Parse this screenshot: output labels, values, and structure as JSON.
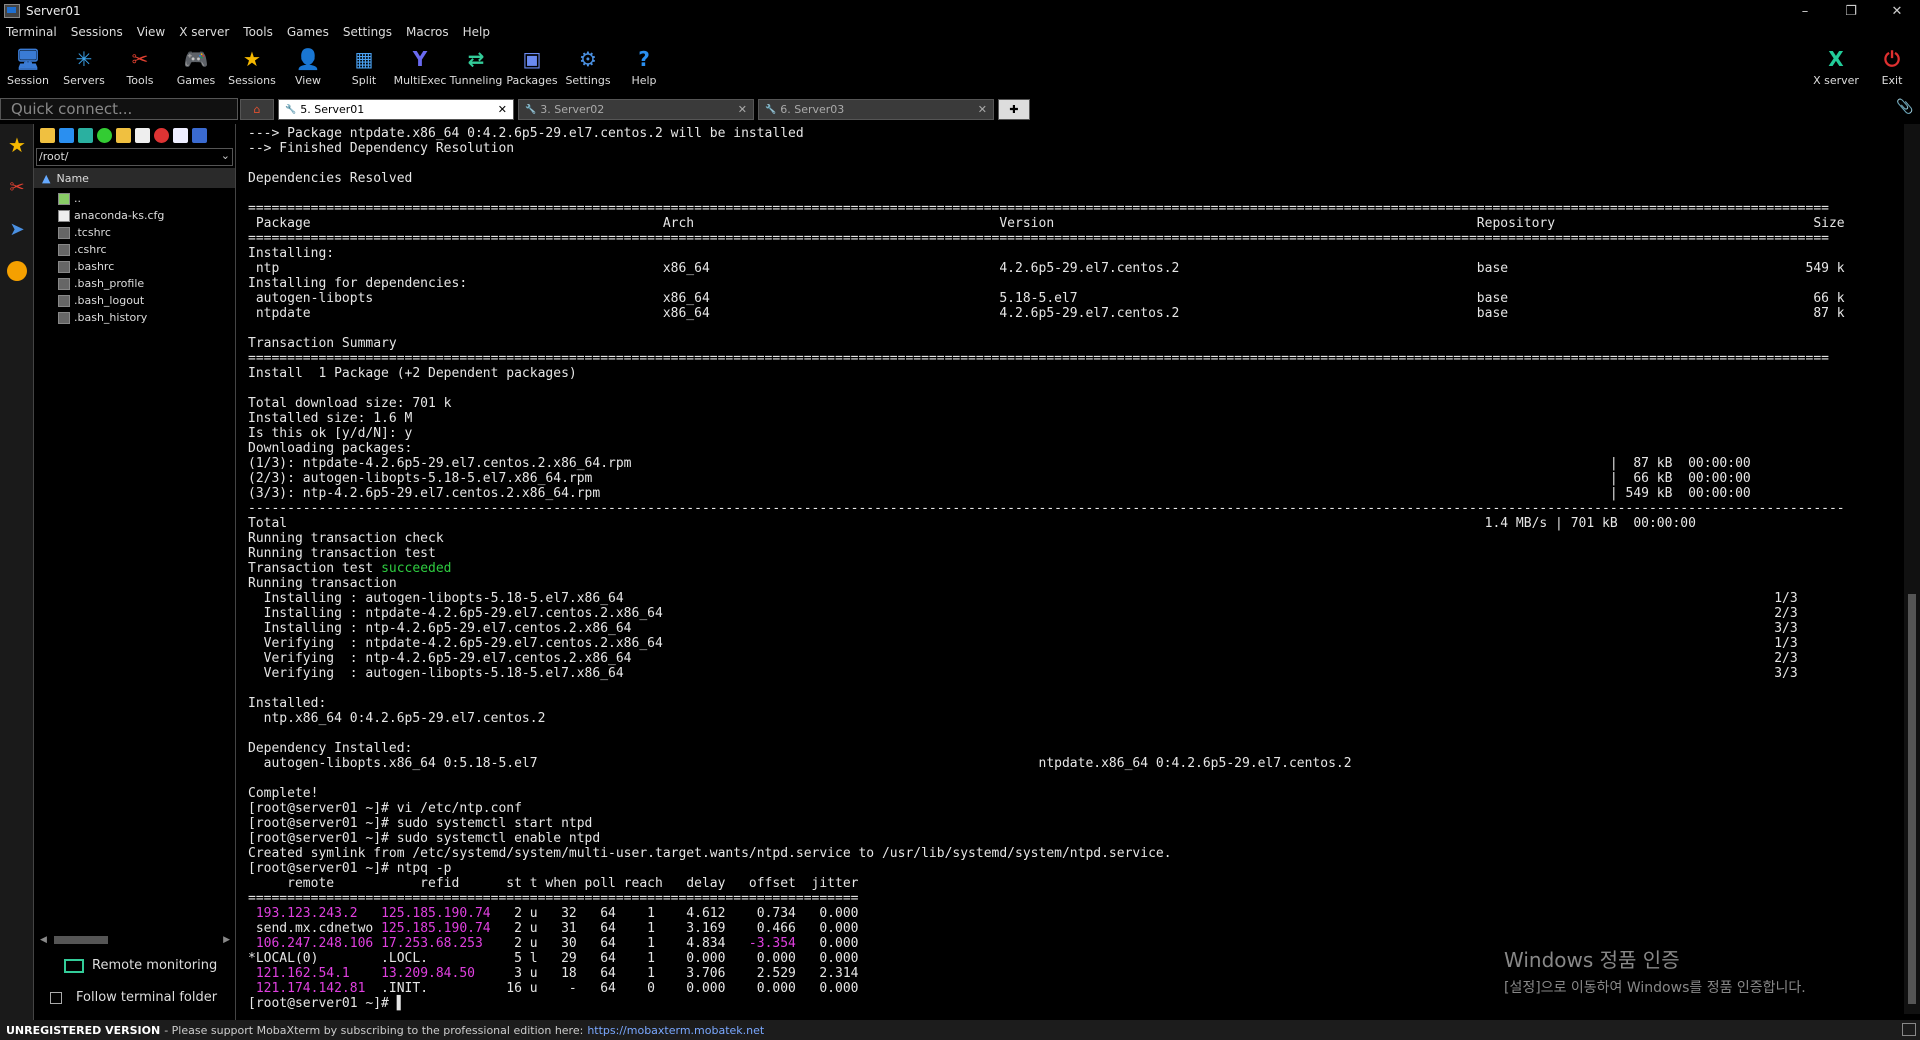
{
  "window": {
    "title": "Server01",
    "min": "–",
    "max": "❐",
    "close": "✕"
  },
  "menu": [
    "Terminal",
    "Sessions",
    "View",
    "X server",
    "Tools",
    "Games",
    "Settings",
    "Macros",
    "Help"
  ],
  "toolbar": [
    {
      "label": "Session",
      "icon": "session-icon",
      "glyph": "🖥",
      "color": "#3a7bd5"
    },
    {
      "label": "Servers",
      "icon": "servers-icon",
      "glyph": "✳",
      "color": "#3aa0e8"
    },
    {
      "label": "Tools",
      "icon": "tools-icon",
      "glyph": "✂",
      "color": "#e04030"
    },
    {
      "label": "Games",
      "icon": "games-icon",
      "glyph": "🎮",
      "color": "#bbbbbb"
    },
    {
      "label": "Sessions",
      "icon": "sessions-star-icon",
      "glyph": "★",
      "color": "#f5b800"
    },
    {
      "label": "View",
      "icon": "view-icon",
      "glyph": "👤",
      "color": "#9ab"
    },
    {
      "label": "Split",
      "icon": "split-icon",
      "glyph": "▦",
      "color": "#4aa0f0"
    },
    {
      "label": "MultiExec",
      "icon": "multiexec-icon",
      "glyph": "Y",
      "color": "#6a6af0"
    },
    {
      "label": "Tunneling",
      "icon": "tunneling-icon",
      "glyph": "⇄",
      "color": "#3c9"
    },
    {
      "label": "Packages",
      "icon": "packages-icon",
      "glyph": "▣",
      "color": "#6a8af0"
    },
    {
      "label": "Settings",
      "icon": "settings-gear-icon",
      "glyph": "⚙",
      "color": "#4a90e2"
    },
    {
      "label": "Help",
      "icon": "help-icon",
      "glyph": "?",
      "color": "#2a8ff0"
    }
  ],
  "toolbar_right": [
    {
      "label": "X server",
      "icon": "xserver-icon",
      "glyph": "X",
      "color": "#2c9"
    },
    {
      "label": "Exit",
      "icon": "exit-power-icon",
      "glyph": "⏻",
      "color": "#e03030"
    }
  ],
  "quick_connect": {
    "placeholder": "Quick connect..."
  },
  "tabs": [
    {
      "label": "5. Server01",
      "active": true
    },
    {
      "label": "3. Server02",
      "active": false
    },
    {
      "label": "6. Server03",
      "active": false
    }
  ],
  "sidebar": {
    "path": "/root/",
    "header": "Name",
    "files": [
      {
        "name": "..",
        "type": "up"
      },
      {
        "name": "anaconda-ks.cfg",
        "type": "doc"
      },
      {
        "name": ".tcshrc",
        "type": "file"
      },
      {
        "name": ".cshrc",
        "type": "file"
      },
      {
        "name": ".bashrc",
        "type": "file"
      },
      {
        "name": ".bash_profile",
        "type": "file"
      },
      {
        "name": ".bash_logout",
        "type": "file"
      },
      {
        "name": ".bash_history",
        "type": "file"
      }
    ],
    "remote_monitoring": "Remote monitoring",
    "follow_folder": "Follow terminal folder"
  },
  "terminal": {
    "lines": [
      [
        {
          "t": "---> Package ntpdate.x86_64 0:4.2.6p5-29.el7.centos.2 will be installed"
        }
      ],
      [
        {
          "t": "--> Finished Dependency Resolution"
        }
      ],
      [
        {
          "t": ""
        }
      ],
      [
        {
          "t": "Dependencies Resolved"
        }
      ],
      [
        {
          "t": ""
        }
      ],
      [
        {
          "t": "=========================================================================================================================================================================================================="
        }
      ],
      [
        {
          "t": " Package                                             Arch                                       Version                                                      Repository                                 Size"
        }
      ],
      [
        {
          "t": "=========================================================================================================================================================================================================="
        }
      ],
      [
        {
          "t": "Installing:"
        }
      ],
      [
        {
          "t": " ntp                                                 x86_64                                     4.2.6p5-29.el7.centos.2                                      base                                      549 k"
        }
      ],
      [
        {
          "t": "Installing for dependencies:"
        }
      ],
      [
        {
          "t": " autogen-libopts                                     x86_64                                     5.18-5.el7                                                   base                                       66 k"
        }
      ],
      [
        {
          "t": " ntpdate                                             x86_64                                     4.2.6p5-29.el7.centos.2                                      base                                       87 k"
        }
      ],
      [
        {
          "t": ""
        }
      ],
      [
        {
          "t": "Transaction Summary"
        }
      ],
      [
        {
          "t": "=========================================================================================================================================================================================================="
        }
      ],
      [
        {
          "t": "Install  1 Package (+2 Dependent packages)"
        }
      ],
      [
        {
          "t": ""
        }
      ],
      [
        {
          "t": "Total download size: 701 k"
        }
      ],
      [
        {
          "t": "Installed size: 1.6 M"
        }
      ],
      [
        {
          "t": "Is this ok [y/d/N]: y"
        }
      ],
      [
        {
          "t": "Downloading packages:"
        }
      ],
      [
        {
          "t": "(1/3): ntpdate-4.2.6p5-29.el7.centos.2.x86_64.rpm                                                                                                                             |  87 kB  00:00:00"
        }
      ],
      [
        {
          "t": "(2/3): autogen-libopts-5.18-5.el7.x86_64.rpm                                                                                                                                  |  66 kB  00:00:00"
        }
      ],
      [
        {
          "t": "(3/3): ntp-4.2.6p5-29.el7.centos.2.x86_64.rpm                                                                                                                                 | 549 kB  00:00:00"
        }
      ],
      [
        {
          "t": "------------------------------------------------------------------------------------------------------------------------------------------------------------------------------------------------------------"
        }
      ],
      [
        {
          "t": "Total                                                                                                                                                         1.4 MB/s | 701 kB  00:00:00"
        }
      ],
      [
        {
          "t": "Running transaction check"
        }
      ],
      [
        {
          "t": "Running transaction test"
        }
      ],
      [
        {
          "t": "Transaction test "
        },
        {
          "t": "succeeded",
          "c": "g"
        }
      ],
      [
        {
          "t": "Running transaction"
        }
      ],
      [
        {
          "t": "  Installing : autogen-libopts-5.18-5.el7.x86_64                                                                                                                                                   1/3"
        }
      ],
      [
        {
          "t": "  Installing : ntpdate-4.2.6p5-29.el7.centos.2.x86_64                                                                                                                                              2/3"
        }
      ],
      [
        {
          "t": "  Installing : ntp-4.2.6p5-29.el7.centos.2.x86_64                                                                                                                                                  3/3"
        }
      ],
      [
        {
          "t": "  Verifying  : ntpdate-4.2.6p5-29.el7.centos.2.x86_64                                                                                                                                              1/3"
        }
      ],
      [
        {
          "t": "  Verifying  : ntp-4.2.6p5-29.el7.centos.2.x86_64                                                                                                                                                  2/3"
        }
      ],
      [
        {
          "t": "  Verifying  : autogen-libopts-5.18-5.el7.x86_64                                                                                                                                                   3/3"
        }
      ],
      [
        {
          "t": ""
        }
      ],
      [
        {
          "t": "Installed:"
        }
      ],
      [
        {
          "t": "  ntp.x86_64 0:4.2.6p5-29.el7.centos.2"
        }
      ],
      [
        {
          "t": ""
        }
      ],
      [
        {
          "t": "Dependency Installed:"
        }
      ],
      [
        {
          "t": "  autogen-libopts.x86_64 0:5.18-5.el7                                                                ntpdate.x86_64 0:4.2.6p5-29.el7.centos.2"
        }
      ],
      [
        {
          "t": ""
        }
      ],
      [
        {
          "t": "Complete!"
        }
      ],
      [
        {
          "t": "[root@server01 ~]# vi /etc/ntp.conf"
        }
      ],
      [
        {
          "t": "[root@server01 ~]# sudo systemctl start ntpd"
        }
      ],
      [
        {
          "t": "[root@server01 ~]# sudo systemctl enable ntpd"
        }
      ],
      [
        {
          "t": "Created symlink from /etc/systemd/system/multi-user.target.wants/ntpd.service to /usr/lib/systemd/system/ntpd.service."
        }
      ],
      [
        {
          "t": "[root@server01 ~]# ntpq -p"
        }
      ],
      [
        {
          "t": "     remote           refid      st t when poll reach   delay   offset  jitter"
        }
      ],
      [
        {
          "t": "=============================================================================="
        }
      ],
      [
        {
          "t": " "
        },
        {
          "t": "193.123.243.2",
          "c": "m"
        },
        {
          "t": "   "
        },
        {
          "t": "125.185.190.74",
          "c": "m"
        },
        {
          "t": "   2 u   32   64    1    4.612    0.734   0.000"
        }
      ],
      [
        {
          "t": " send.mx.cdnetwo "
        },
        {
          "t": "125.185.190.74",
          "c": "m"
        },
        {
          "t": "   2 u   31   64    1    3.169    0.466   0.000"
        }
      ],
      [
        {
          "t": " "
        },
        {
          "t": "106.247.248.106",
          "c": "m"
        },
        {
          "t": " "
        },
        {
          "t": "17.253.68.253",
          "c": "m"
        },
        {
          "t": "    2 u   30   64    1    4.834   "
        },
        {
          "t": "-3.354",
          "c": "m"
        },
        {
          "t": "   0.000"
        }
      ],
      [
        {
          "t": "*LOCAL(0)        .LOCL.           5 l   29   64    1    0.000    0.000   0.000"
        }
      ],
      [
        {
          "t": " "
        },
        {
          "t": "121.162.54.1",
          "c": "m"
        },
        {
          "t": "    "
        },
        {
          "t": "13.209.84.50",
          "c": "m"
        },
        {
          "t": "     3 u   18   64    1    3.706    2.529   2.314"
        }
      ],
      [
        {
          "t": " "
        },
        {
          "t": "121.174.142.81",
          "c": "m"
        },
        {
          "t": "  .INIT.          16 u    -   64    0    0.000    0.000   0.000"
        }
      ],
      [
        {
          "t": "[root@server01 ~]# ▌"
        }
      ]
    ]
  },
  "watermark": {
    "line1": "Windows 정품 인증",
    "line2": "[설정]으로 이동하여 Windows를 정품 인증합니다."
  },
  "statusbar": {
    "unregistered": "UNREGISTERED VERSION",
    "message": " -  Please support MobaXterm by subscribing to the professional edition here:",
    "link": "https://mobaxterm.mobatek.net"
  }
}
